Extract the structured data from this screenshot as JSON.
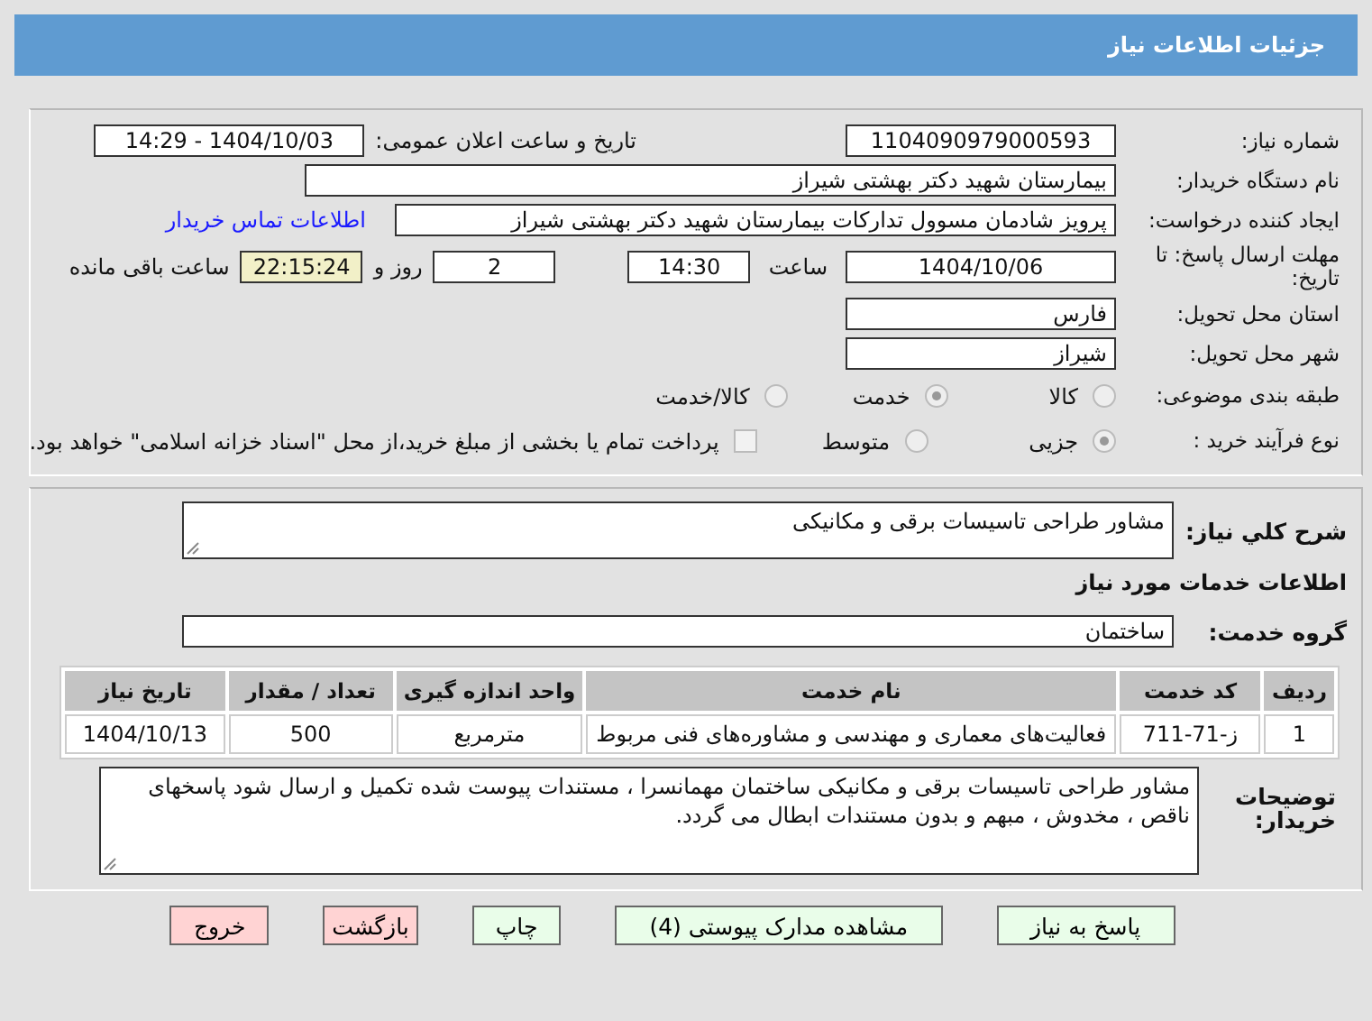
{
  "header": {
    "title": "جزئیات اطلاعات نیاز"
  },
  "need_number": {
    "label": "شماره نیاز:",
    "value": "1104090979000593"
  },
  "announce_date": {
    "label": "تاریخ و ساعت اعلان عمومی:",
    "value": "1404/10/03 - 14:29"
  },
  "buyer_org": {
    "label": "نام دستگاه خریدار:",
    "value": "بیمارستان شهید دکتر بهشتی شیراز"
  },
  "requester": {
    "label": "ایجاد کننده درخواست:",
    "value": "پرویز شادمان مسوول تدارکات بیمارستان شهید دکتر بهشتی شیراز",
    "link": "اطلاعات تماس خریدار"
  },
  "deadline": {
    "label": "مهلت ارسال پاسخ: تا تاریخ:",
    "date": "1404/10/06",
    "time_label": "ساعت",
    "time": "14:30",
    "days": "2",
    "days_label": "روز و",
    "remaining": "22:15:24",
    "remaining_label": "ساعت باقی مانده"
  },
  "province": {
    "label": "استان محل تحویل:",
    "value": "فارس"
  },
  "city": {
    "label": "شهر محل تحویل:",
    "value": "شیراز"
  },
  "category": {
    "label": "طبقه بندی موضوعی:",
    "options": [
      {
        "label": "کالا",
        "selected": false
      },
      {
        "label": "خدمت",
        "selected": true
      },
      {
        "label": "کالا/خدمت",
        "selected": false
      }
    ]
  },
  "purchase_type": {
    "label": "نوع فرآیند خرید :",
    "options": [
      {
        "label": "جزیی",
        "selected": true
      },
      {
        "label": "متوسط",
        "selected": false
      }
    ],
    "treasury": {
      "checked": false,
      "text": "پرداخت تمام یا بخشی از مبلغ خرید،از محل \"اسناد خزانه اسلامی\" خواهد بود."
    }
  },
  "summary": {
    "label": "شرح کلي نياز:",
    "value": "مشاور طراحی تاسیسات برقی و مکانیکی"
  },
  "services_heading": "اطلاعات خدمات مورد نیاز",
  "service_group": {
    "label": "گروه خدمت:",
    "value": "ساختمان"
  },
  "table": {
    "columns": [
      "ردیف",
      "کد خدمت",
      "نام خدمت",
      "واحد اندازه گیری",
      "تعداد / مقدار",
      "تاریخ نیاز"
    ],
    "rows": [
      [
        "1",
        "ز-71-711",
        "فعالیت‌های معماری و مهندسی و مشاوره‌های فنی مربوط",
        "مترمربع",
        "500",
        "1404/10/13"
      ]
    ]
  },
  "buyer_notes": {
    "label": "توضیحات خریدار:",
    "value": "مشاور طراحی تاسیسات برقی و مکانیکی ساختمان مهمانسرا ، مستندات پیوست شده تکمیل و ارسال شود پاسخهای ناقص ، مخدوش ، مبهم و بدون مستندات ابطال می گردد."
  },
  "buttons": [
    {
      "label": "پاسخ به نیاز",
      "kind": "normal"
    },
    {
      "label": "مشاهده مدارک پیوستی (4)",
      "kind": "normal"
    },
    {
      "label": "چاپ",
      "kind": "normal"
    },
    {
      "label": "بازگشت",
      "kind": "danger"
    },
    {
      "label": "خروج",
      "kind": "danger"
    }
  ]
}
